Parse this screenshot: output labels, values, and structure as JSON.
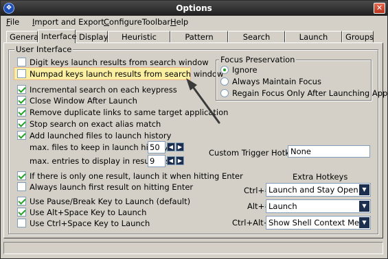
{
  "window": {
    "title": "Options"
  },
  "menu": [
    {
      "label": "File",
      "underline": "F",
      "rest": "ile"
    },
    {
      "label": "Import and Export",
      "underline": "I",
      "rest": "mport and Export"
    },
    {
      "label": "ConfigureToolbar",
      "underline": "C",
      "rest": "onfigureToolbar"
    },
    {
      "label": "Help",
      "underline": "H",
      "rest": "elp"
    }
  ],
  "tabs": [
    "General",
    "Interface",
    "Display",
    "Heuristic Scoring",
    "Pattern Scoring",
    "Search Folders",
    "Launch History",
    "Groups"
  ],
  "active_tab": "Interface",
  "user_interface": {
    "legend": "User Interface",
    "digit_keys": "Digit keys launch results from search window",
    "numpad_keys": "Numpad keys launch results from search window",
    "incremental": "Incremental search on each keypress",
    "close_window": "Close Window After Launch",
    "remove_duplicate": "Remove duplicate links to same target application",
    "stop_search": "Stop search on exact alias match",
    "add_history": "Add launched files to launch history",
    "max_history_label": "max. files to keep in launch history:",
    "max_history_value": "50",
    "max_entries_label": "max. entries to display in results list:",
    "max_entries_value": "9",
    "only_one": "If there is only one result, launch it when hitting Enter",
    "always_first": "Always launch first result on hitting Enter",
    "pause_break": "Use Pause/Break Key to Launch (default)",
    "alt_space": "Use Alt+Space Key to Launch",
    "ctrl_space": "Use Ctrl+Space Key to Launch"
  },
  "checked": {
    "digit_keys": false,
    "numpad_keys": false,
    "incremental": true,
    "close_window": true,
    "remove_duplicate": true,
    "stop_search": true,
    "add_history": true,
    "only_one": true,
    "always_first": false,
    "pause_break": true,
    "alt_space": true,
    "ctrl_space": false
  },
  "focus": {
    "legend": "Focus Preservation",
    "options": [
      "Ignore",
      "Always Maintain Focus",
      "Regain Focus Only After Launching Apps"
    ],
    "selected": "Ignore"
  },
  "custom_trigger": {
    "label": "Custom Trigger Hotkey:",
    "value": "None"
  },
  "extra_hotkeys": {
    "title": "Extra Hotkeys",
    "rows": [
      {
        "label": "Ctrl+#",
        "value": "Launch and Stay Open"
      },
      {
        "label": "Alt+#",
        "value": "Launch"
      },
      {
        "label": "Ctrl+Alt+#",
        "value": "Show Shell Context Menu"
      }
    ]
  },
  "colors": {
    "highlight_fill": "#faeea0",
    "arrow": "#3a3a3a",
    "check": "#21a121"
  },
  "icons": {
    "app": "app-icon",
    "close": "close-icon",
    "spin": "spin-arrow-icon",
    "dropdown": "chevron-down-icon"
  }
}
